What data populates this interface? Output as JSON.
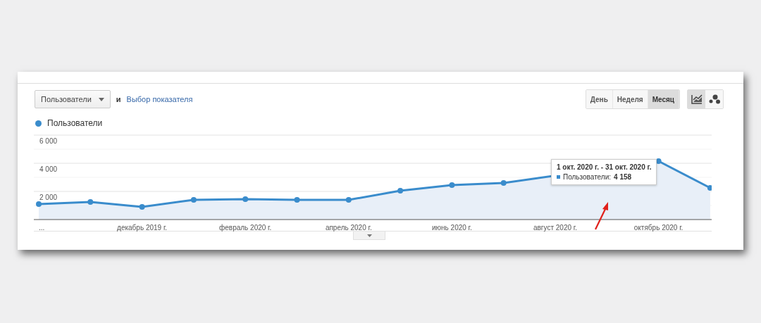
{
  "metric_select": {
    "value": "Пользователи"
  },
  "conjunction": "и",
  "metric_link": "Выбор показателя",
  "periods": [
    {
      "label": "День",
      "selected": false
    },
    {
      "label": "Неделя",
      "selected": false
    },
    {
      "label": "Месяц",
      "selected": true
    }
  ],
  "chart_types": [
    {
      "kind": "line",
      "selected": true
    },
    {
      "kind": "bubbles",
      "selected": false
    }
  ],
  "chart": {
    "chart_data": {
      "type": "area",
      "categories": [
        "...",
        null,
        "декабрь 2019 г.",
        null,
        "февраль 2020 г.",
        null,
        "апрель 2020 г.",
        null,
        "июнь 2020 г.",
        null,
        "август 2020 г.",
        null,
        "октябрь 2020 г.",
        null
      ],
      "ylim": [
        0,
        6000
      ],
      "yticks": [
        {
          "value": 2000,
          "label": "2 000"
        },
        {
          "value": 4000,
          "label": "4 000"
        },
        {
          "value": 6000,
          "label": "6 000"
        }
      ],
      "series": [
        {
          "name": "Пользователи",
          "color": "#3a8ccc",
          "values": [
            1100,
            1250,
            900,
            1400,
            1450,
            1400,
            1400,
            2050,
            2450,
            2600,
            null,
            null,
            4150,
            2250
          ]
        }
      ]
    }
  },
  "tooltip": {
    "title": "1 окт. 2020 г. - 31 окт. 2020 г.",
    "label": "Пользователи:",
    "value": "4 158"
  }
}
